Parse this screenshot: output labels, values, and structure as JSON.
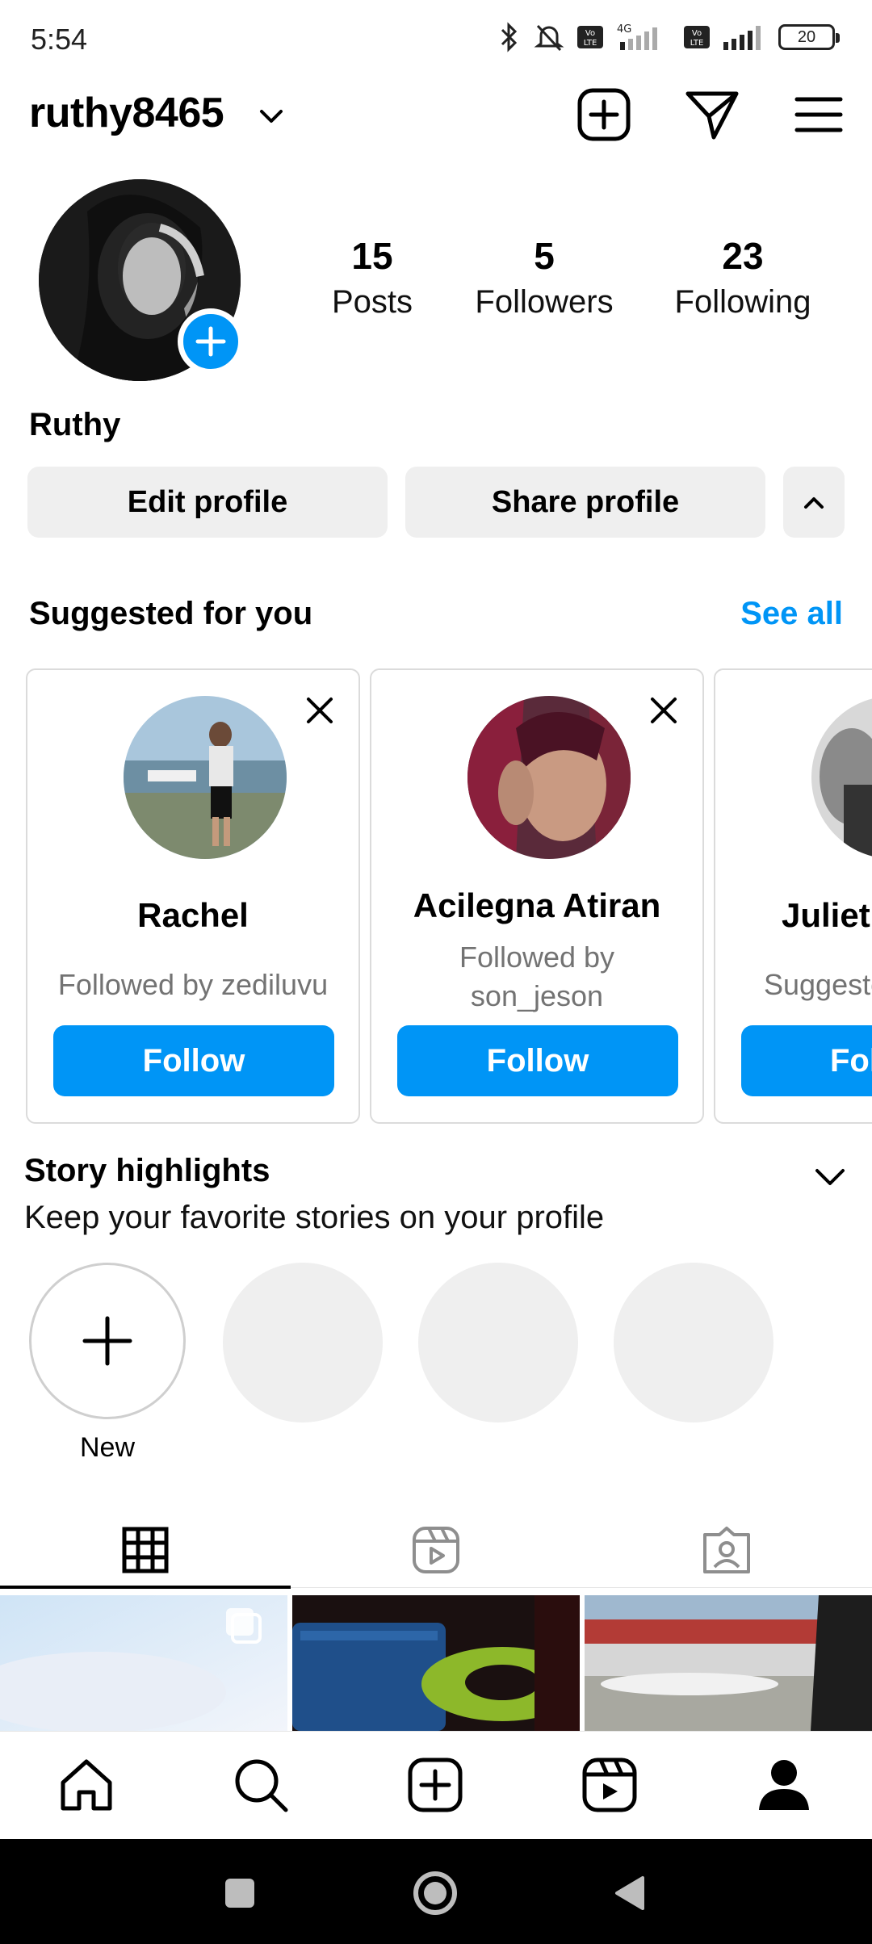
{
  "status_bar": {
    "time": "5:54",
    "battery": "20"
  },
  "header": {
    "username": "ruthy8465"
  },
  "profile": {
    "stats": [
      {
        "value": "15",
        "label": "Posts"
      },
      {
        "value": "5",
        "label": "Followers"
      },
      {
        "value": "23",
        "label": "Following"
      }
    ],
    "full_name": "Ruthy",
    "edit_label": "Edit profile",
    "share_label": "Share profile"
  },
  "suggested": {
    "title": "Suggested for you",
    "see_all": "See all",
    "cards": [
      {
        "name": "Rachel",
        "subtitle": "Followed by zediluvu",
        "button": "Follow"
      },
      {
        "name": "Acilegna Atiran",
        "subtitle": "Followed by son_jeson",
        "button": "Follow"
      },
      {
        "name": "Juliet",
        "subtitle": "Suggeste",
        "button": "Fol"
      }
    ]
  },
  "highlights": {
    "title": "Story highlights",
    "subtitle": "Keep your favorite stories on your profile",
    "new_label": "New"
  },
  "colors": {
    "accent": "#0095f6",
    "button_bg": "#efefef",
    "muted_text": "#737373"
  },
  "icons": {
    "header": [
      "new-post-icon",
      "direct-message-icon",
      "menu-icon"
    ],
    "tabs": [
      "grid-icon",
      "reels-icon",
      "tagged-icon"
    ],
    "bottom_nav": [
      "home-icon",
      "search-icon",
      "create-icon",
      "reels-icon",
      "profile-icon"
    ]
  }
}
